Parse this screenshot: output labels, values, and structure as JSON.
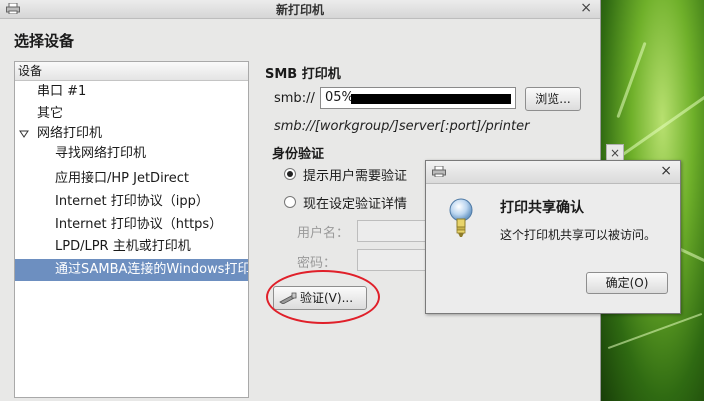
{
  "window": {
    "title": "新打印机",
    "close": "×"
  },
  "heading": "选择设备",
  "device_list": {
    "header": "设备",
    "items": [
      {
        "label": "串口 #1"
      },
      {
        "label": "其它"
      },
      {
        "label": "网络打印机",
        "expanded": true
      },
      {
        "label": "寻找网络打印机"
      },
      {
        "label": "应用接口/HP JetDirect"
      },
      {
        "label": "Internet 打印协议（ipp）"
      },
      {
        "label": "Internet 打印协议（https）"
      },
      {
        "label": "LPD/LPR 主机或打印机"
      },
      {
        "label": "通过SAMBA连接的Windows打印",
        "selected": true
      }
    ]
  },
  "smb": {
    "section_title": "SMB 打印机",
    "prefix_label": "smb://",
    "value": "05%",
    "browse_button": "浏览...",
    "hint": "smb://[workgroup/]server[:port]/printer"
  },
  "auth": {
    "title": "身份验证",
    "option_prompt": "提示用户需要验证",
    "option_now": "现在设定验证详情",
    "selected": "prompt",
    "username_label": "用户名：",
    "password_label": "密码：",
    "verify_button": "验证(V)..."
  },
  "dialog": {
    "close": "×",
    "heading": "打印共享确认",
    "message": "这个打印机共享可以被访问。",
    "ok_button": "确定(O)"
  },
  "colors": {
    "selection": "#6d8fc0",
    "highlight_circle": "#e0202a"
  }
}
